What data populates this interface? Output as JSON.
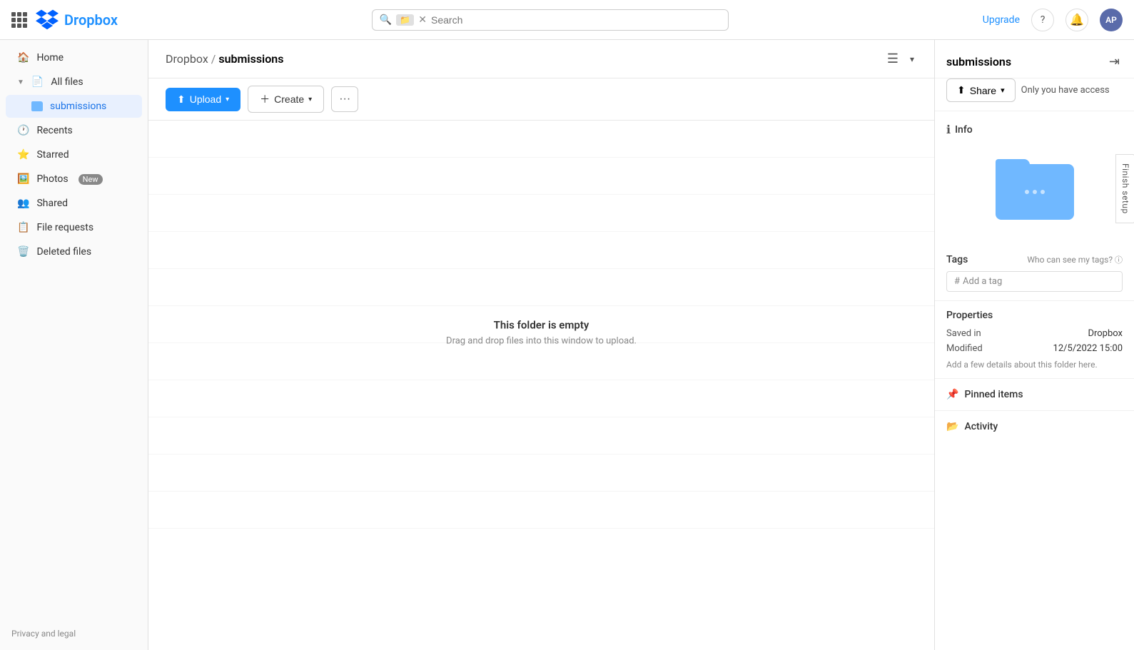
{
  "topbar": {
    "logo_text": "Dropbox",
    "upgrade_label": "Upgrade",
    "search_placeholder": "Search",
    "folder_badge_label": "📁",
    "help_icon": "?",
    "avatar_initials": "AP"
  },
  "sidebar": {
    "items": [
      {
        "id": "home",
        "label": "Home",
        "icon": "home"
      },
      {
        "id": "all-files",
        "label": "All files",
        "icon": "files",
        "expanded": true
      },
      {
        "id": "submissions",
        "label": "submissions",
        "icon": "folder",
        "active": true,
        "indent": true
      },
      {
        "id": "recents",
        "label": "Recents",
        "icon": "clock"
      },
      {
        "id": "starred",
        "label": "Starred",
        "icon": "star"
      },
      {
        "id": "photos",
        "label": "Photos",
        "icon": "photo",
        "badge": "New"
      },
      {
        "id": "shared",
        "label": "Shared",
        "icon": "shared"
      },
      {
        "id": "file-requests",
        "label": "File requests",
        "icon": "file-req"
      },
      {
        "id": "deleted-files",
        "label": "Deleted files",
        "icon": "trash"
      }
    ],
    "footer_label": "Privacy and legal"
  },
  "content": {
    "breadcrumb_root": "Dropbox",
    "breadcrumb_sep": "/",
    "breadcrumb_current": "submissions",
    "upload_label": "Upload",
    "create_label": "Create",
    "more_label": "···",
    "empty_title": "This folder is empty",
    "empty_subtitle": "Drag and drop files into this window to upload."
  },
  "right_panel": {
    "title": "submissions",
    "share_label": "Share",
    "access_text": "Only you have access",
    "info_label": "Info",
    "tags_label": "Tags",
    "tags_help": "Who can see my tags?",
    "tag_placeholder": "# Add a tag",
    "properties_label": "Properties",
    "prop_saved_key": "Saved in",
    "prop_saved_val": "Dropbox",
    "prop_modified_key": "Modified",
    "prop_modified_val": "12/5/2022 15:00",
    "prop_details_text": "Add a few details about this folder here.",
    "pinned_label": "Pinned items",
    "activity_label": "Activity",
    "finish_setup_label": "Finish setup"
  }
}
